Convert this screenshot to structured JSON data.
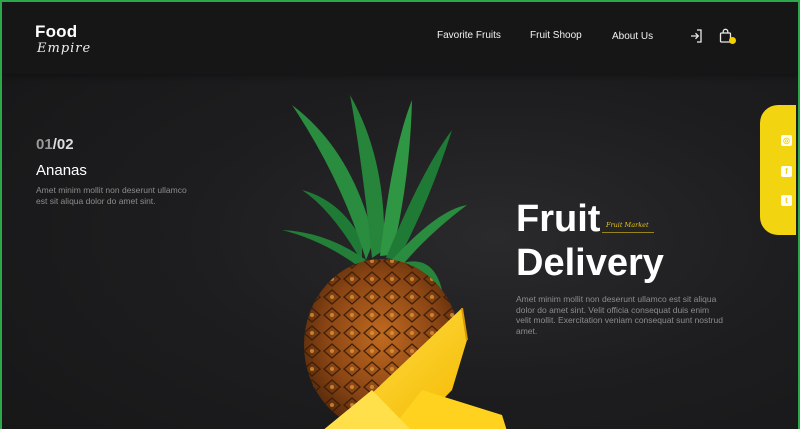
{
  "logo": {
    "main": "Food",
    "sub": "Empire"
  },
  "nav": {
    "items": [
      {
        "label": "Favorite Fruits"
      },
      {
        "label": "Fruit Shoop"
      },
      {
        "label": "About Us"
      }
    ]
  },
  "header_icons": [
    "login-icon",
    "shopping-bag-icon"
  ],
  "slider": {
    "current": "01",
    "separator": "/",
    "total": "02",
    "title": "Ananas",
    "description": "Amet minim mollit non deserunt ullamco est sit aliqua dolor do amet sint."
  },
  "hero": {
    "title_line1": "Fruit",
    "title_line2": "Delivery",
    "tagline": "Fruit Market",
    "description": "Amet minim mollit non deserunt ullamco est sit aliqua dolor do amet sint. Velit officia consequat duis enim velit mollit. Exercitation veniam consequat sunt nostrud amet."
  },
  "social": [
    "instagram-icon",
    "facebook-icon",
    "twitter-icon"
  ],
  "colors": {
    "accent": "#f2d411",
    "background": "#1b1b1c",
    "frame": "#2aa84a"
  }
}
